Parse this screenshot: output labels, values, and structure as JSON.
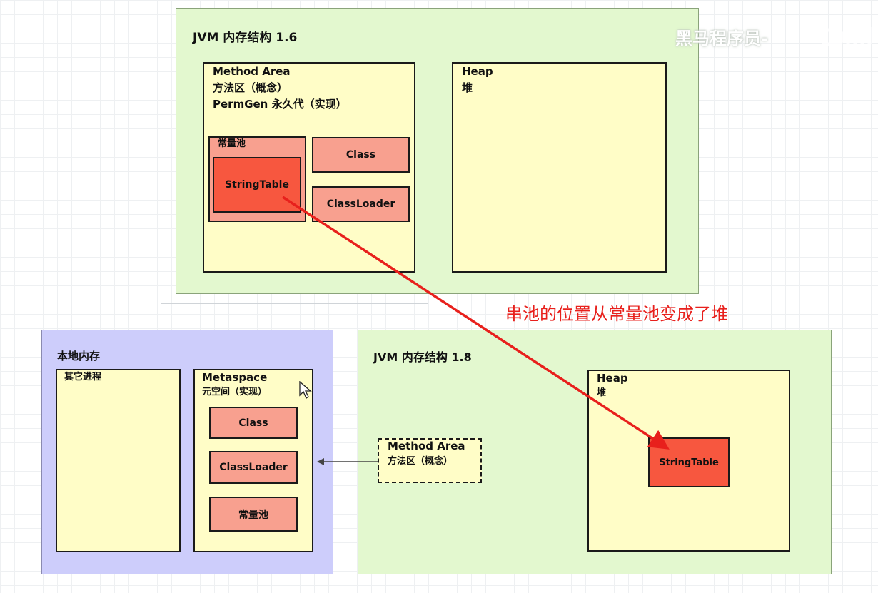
{
  "jvm16": {
    "title": "JVM 内存结构 1.6",
    "method_area": {
      "line1": "Method Area",
      "line2": "方法区（概念）",
      "line3": "PermGen 永久代（实现）"
    },
    "constant_pool_label": "常量池",
    "string_table": "StringTable",
    "class": "Class",
    "class_loader": "ClassLoader",
    "heap": {
      "line1": "Heap",
      "line2": "堆"
    }
  },
  "native": {
    "title": "本地内存",
    "other_processes": "其它进程",
    "metaspace": {
      "line1": "Metaspace",
      "line2": "元空间（实现）"
    },
    "class": "Class",
    "class_loader": "ClassLoader",
    "constant_pool": "常量池"
  },
  "jvm18": {
    "title": "JVM 内存结构 1.8",
    "method_area": {
      "line1": "Method Area",
      "line2": "方法区（概念）"
    },
    "heap": {
      "line1": "Heap",
      "line2": "堆"
    },
    "string_table": "StringTable"
  },
  "annotation": "串池的位置从常量池变成了堆",
  "watermark": "黑马程序员-",
  "colors": {
    "panel_green": "#e3f8cf",
    "panel_purple": "#cdcdfb",
    "area_yellow": "#fffdc7",
    "block_salmon": "#f8a08f",
    "block_red": "#f7573f",
    "arrow_red": "#e8201c",
    "arrow_dark": "#444444"
  }
}
